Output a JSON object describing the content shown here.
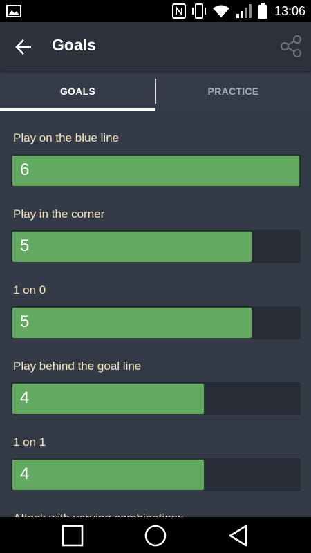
{
  "status_bar": {
    "time": "13:06",
    "icons": [
      "gallery-icon",
      "nfc-icon",
      "vibrate-icon",
      "wifi-icon",
      "signal-icon",
      "battery-icon"
    ]
  },
  "app_bar": {
    "title": "Goals",
    "icons": [
      "back-arrow-icon",
      "share-icon"
    ]
  },
  "tabs": [
    {
      "label": "GOALS",
      "selected": true
    },
    {
      "label": "PRACTICE",
      "selected": false
    }
  ],
  "goals": {
    "max_value": 6,
    "items": [
      {
        "label": "Play on the blue line",
        "value": "6"
      },
      {
        "label": "Play in the corner",
        "value": "5"
      },
      {
        "label": "1 on 0",
        "value": "5"
      },
      {
        "label": "Play behind the goal line",
        "value": "4"
      },
      {
        "label": "1 on 1",
        "value": "4"
      },
      {
        "label": "Attack with varying combinations",
        "value": ""
      }
    ]
  },
  "colors": {
    "background": "#343a46",
    "app_bar": "#2c313b",
    "bar_fill": "#64a962",
    "bar_track": "#272c36",
    "label_text": "#f3e7c0"
  },
  "nav_bar": {
    "icons": [
      "recents-square-icon",
      "home-circle-icon",
      "back-triangle-icon"
    ]
  }
}
